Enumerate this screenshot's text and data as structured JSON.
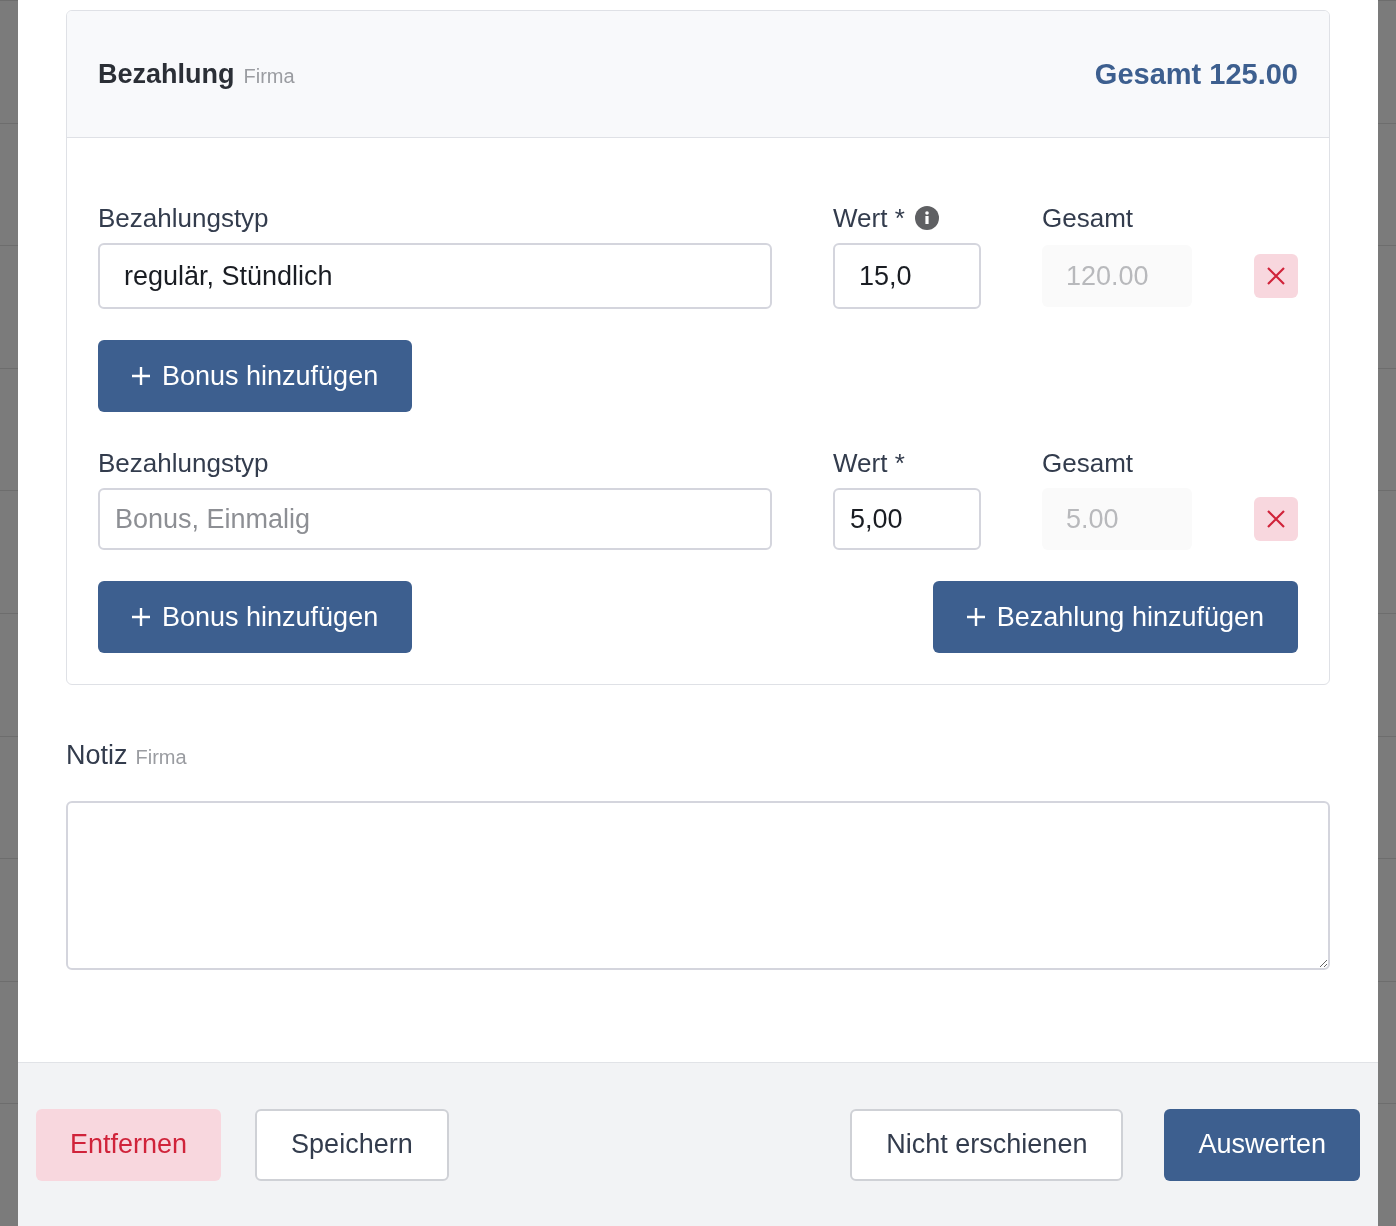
{
  "payment": {
    "title": "Bezahlung",
    "subtitle": "Firma",
    "total": "Gesamt 125.00",
    "rows": [
      {
        "type_label": "Bezahlungstyp",
        "type_field": {
          "value": "regulär, Stündlich"
        },
        "value_label": "Wert *",
        "value_info": true,
        "value": "15,0",
        "total_label": "Gesamt",
        "total_field": {
          "value": "120.00",
          "disabled": true
        },
        "bonus_button": "Bonus hinzufügen"
      },
      {
        "type_label": "Bezahlungstyp",
        "type_field": {
          "placeholder": "Bonus, Einmalig"
        },
        "value_label": "Wert *",
        "value_info": false,
        "value": "5,00",
        "total_label": "Gesamt",
        "total_field": {
          "value": "5.00",
          "disabled": true
        },
        "bonus_button": "Bonus hinzufügen"
      }
    ],
    "add_payment_button": "Bezahlung hinzufügen"
  },
  "note": {
    "label": "Notiz",
    "sublabel": "Firma"
  },
  "footer": {
    "left": [
      {
        "label": "Entfernen",
        "kind": "danger"
      },
      {
        "label": "Speichern",
        "kind": "secondary"
      }
    ],
    "right": [
      {
        "label": "Nicht erschienen",
        "kind": "secondary"
      },
      {
        "label": "Auswerten",
        "kind": "primary"
      }
    ]
  }
}
